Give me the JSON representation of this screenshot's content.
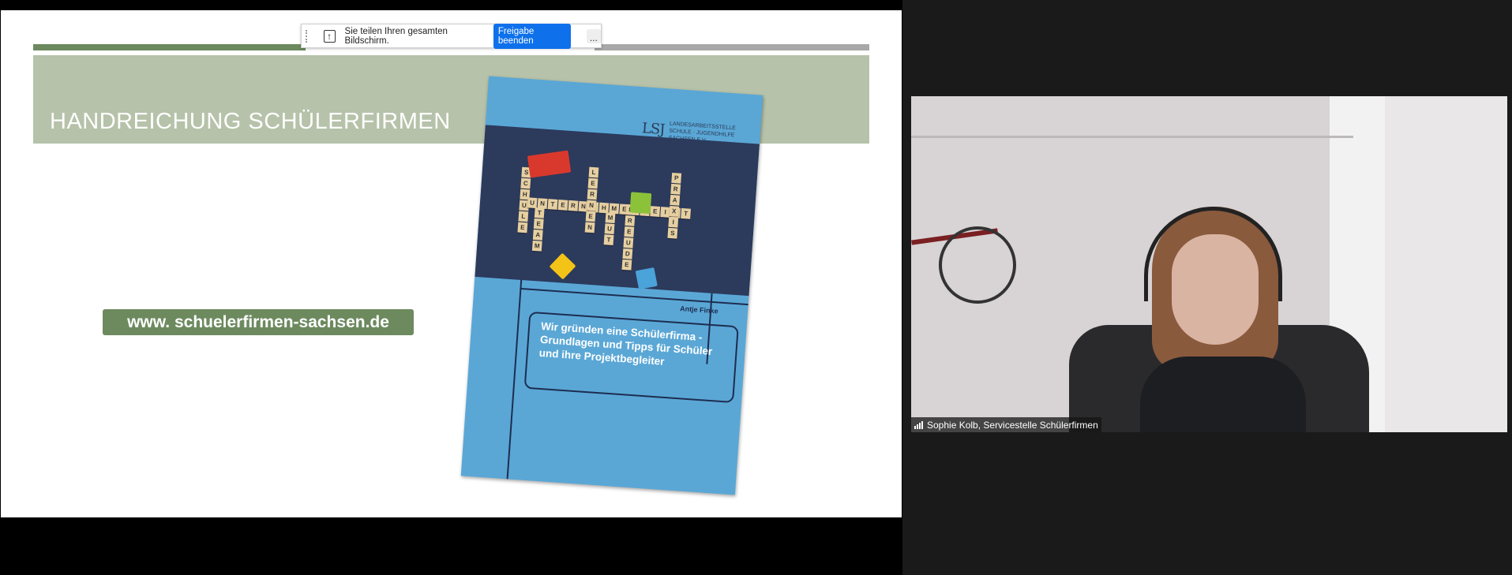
{
  "slide": {
    "title": "HANDREICHUNG SCHÜLERFIRMEN",
    "url": "www. schuelerfirmen-sachsen.de",
    "book": {
      "logo_mark": "LSJ",
      "logo_line1": "Landesarbeitsstelle",
      "logo_line2": "Schule · Jugendhilfe Sachsen e.V.",
      "author": "Antje Finke",
      "subtitle": "Wir gründen eine Schülerfirma - Grundlagen und Tipps für Schüler und ihre Projektbegleiter",
      "tile_words": [
        "SCHULE",
        "UNTERNEHMERGEIST",
        "LERNEN",
        "TEAM",
        "MUT",
        "FREUDE",
        "PRAXIS"
      ]
    }
  },
  "share_toolbar": {
    "message": "Sie teilen Ihren gesamten Bildschirm.",
    "stop_label": "Freigabe beenden",
    "more_label": "..."
  },
  "video": {
    "participant_name": "Sophie Kolb, Servicestelle Schülerfirmen"
  },
  "colors": {
    "slide_green": "#6d8a5f",
    "header_band": "#b6c2a9",
    "book_blue": "#5aa7d6",
    "stop_button": "#0e71eb"
  }
}
